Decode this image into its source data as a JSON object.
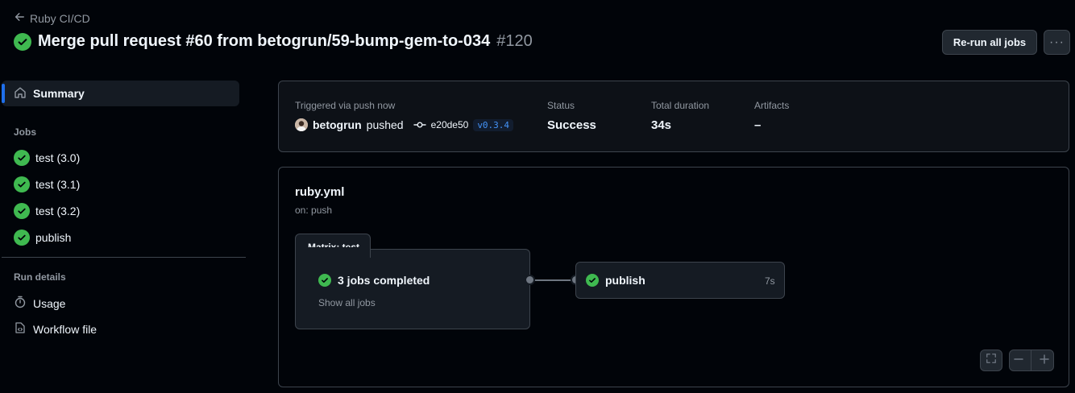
{
  "header": {
    "back_label": "Ruby CI/CD",
    "title": "Merge pull request #60 from betogrun/59-bump-gem-to-034",
    "run_number": "#120",
    "rerun_label": "Re-run all jobs",
    "more_label": "···"
  },
  "sidebar": {
    "summary_label": "Summary",
    "jobs_heading": "Jobs",
    "jobs": [
      {
        "label": "test (3.0)",
        "status": "success"
      },
      {
        "label": "test (3.1)",
        "status": "success"
      },
      {
        "label": "test (3.2)",
        "status": "success"
      },
      {
        "label": "publish",
        "status": "success"
      }
    ],
    "run_details_heading": "Run details",
    "usage_label": "Usage",
    "workflow_file_label": "Workflow file"
  },
  "summary": {
    "trigger_label": "Triggered via push now",
    "actor": "betogrun",
    "action": "pushed",
    "commit": "e20de50",
    "tag": "v0.3.4",
    "status_label": "Status",
    "status_value": "Success",
    "duration_label": "Total duration",
    "duration_value": "34s",
    "artifacts_label": "Artifacts",
    "artifacts_value": "–"
  },
  "workflow": {
    "file": "ruby.yml",
    "event": "on: push",
    "matrix_label": "Matrix: test",
    "matrix_status": "3 jobs completed",
    "show_all": "Show all jobs",
    "publish_label": "publish",
    "publish_duration": "7s"
  },
  "colors": {
    "success": "#3fb950",
    "accent": "#1f6feb",
    "background": "#010409",
    "card": "#0d1117",
    "border": "#3d444d"
  }
}
